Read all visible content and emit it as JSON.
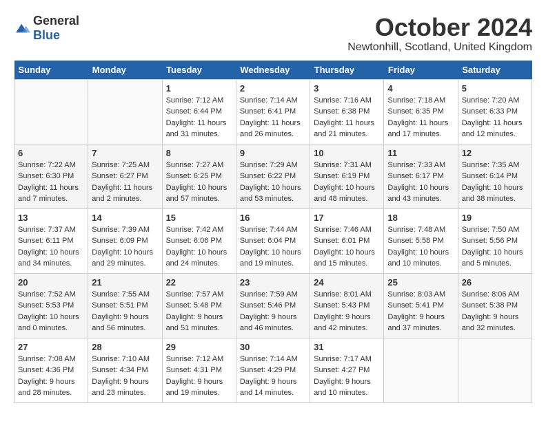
{
  "logo": {
    "general": "General",
    "blue": "Blue"
  },
  "title": "October 2024",
  "location": "Newtonhill, Scotland, United Kingdom",
  "headers": [
    "Sunday",
    "Monday",
    "Tuesday",
    "Wednesday",
    "Thursday",
    "Friday",
    "Saturday"
  ],
  "weeks": [
    [
      {
        "day": "",
        "info": ""
      },
      {
        "day": "",
        "info": ""
      },
      {
        "day": "1",
        "info": "Sunrise: 7:12 AM\nSunset: 6:44 PM\nDaylight: 11 hours and 31 minutes."
      },
      {
        "day": "2",
        "info": "Sunrise: 7:14 AM\nSunset: 6:41 PM\nDaylight: 11 hours and 26 minutes."
      },
      {
        "day": "3",
        "info": "Sunrise: 7:16 AM\nSunset: 6:38 PM\nDaylight: 11 hours and 21 minutes."
      },
      {
        "day": "4",
        "info": "Sunrise: 7:18 AM\nSunset: 6:35 PM\nDaylight: 11 hours and 17 minutes."
      },
      {
        "day": "5",
        "info": "Sunrise: 7:20 AM\nSunset: 6:33 PM\nDaylight: 11 hours and 12 minutes."
      }
    ],
    [
      {
        "day": "6",
        "info": "Sunrise: 7:22 AM\nSunset: 6:30 PM\nDaylight: 11 hours and 7 minutes."
      },
      {
        "day": "7",
        "info": "Sunrise: 7:25 AM\nSunset: 6:27 PM\nDaylight: 11 hours and 2 minutes."
      },
      {
        "day": "8",
        "info": "Sunrise: 7:27 AM\nSunset: 6:25 PM\nDaylight: 10 hours and 57 minutes."
      },
      {
        "day": "9",
        "info": "Sunrise: 7:29 AM\nSunset: 6:22 PM\nDaylight: 10 hours and 53 minutes."
      },
      {
        "day": "10",
        "info": "Sunrise: 7:31 AM\nSunset: 6:19 PM\nDaylight: 10 hours and 48 minutes."
      },
      {
        "day": "11",
        "info": "Sunrise: 7:33 AM\nSunset: 6:17 PM\nDaylight: 10 hours and 43 minutes."
      },
      {
        "day": "12",
        "info": "Sunrise: 7:35 AM\nSunset: 6:14 PM\nDaylight: 10 hours and 38 minutes."
      }
    ],
    [
      {
        "day": "13",
        "info": "Sunrise: 7:37 AM\nSunset: 6:11 PM\nDaylight: 10 hours and 34 minutes."
      },
      {
        "day": "14",
        "info": "Sunrise: 7:39 AM\nSunset: 6:09 PM\nDaylight: 10 hours and 29 minutes."
      },
      {
        "day": "15",
        "info": "Sunrise: 7:42 AM\nSunset: 6:06 PM\nDaylight: 10 hours and 24 minutes."
      },
      {
        "day": "16",
        "info": "Sunrise: 7:44 AM\nSunset: 6:04 PM\nDaylight: 10 hours and 19 minutes."
      },
      {
        "day": "17",
        "info": "Sunrise: 7:46 AM\nSunset: 6:01 PM\nDaylight: 10 hours and 15 minutes."
      },
      {
        "day": "18",
        "info": "Sunrise: 7:48 AM\nSunset: 5:58 PM\nDaylight: 10 hours and 10 minutes."
      },
      {
        "day": "19",
        "info": "Sunrise: 7:50 AM\nSunset: 5:56 PM\nDaylight: 10 hours and 5 minutes."
      }
    ],
    [
      {
        "day": "20",
        "info": "Sunrise: 7:52 AM\nSunset: 5:53 PM\nDaylight: 10 hours and 0 minutes."
      },
      {
        "day": "21",
        "info": "Sunrise: 7:55 AM\nSunset: 5:51 PM\nDaylight: 9 hours and 56 minutes."
      },
      {
        "day": "22",
        "info": "Sunrise: 7:57 AM\nSunset: 5:48 PM\nDaylight: 9 hours and 51 minutes."
      },
      {
        "day": "23",
        "info": "Sunrise: 7:59 AM\nSunset: 5:46 PM\nDaylight: 9 hours and 46 minutes."
      },
      {
        "day": "24",
        "info": "Sunrise: 8:01 AM\nSunset: 5:43 PM\nDaylight: 9 hours and 42 minutes."
      },
      {
        "day": "25",
        "info": "Sunrise: 8:03 AM\nSunset: 5:41 PM\nDaylight: 9 hours and 37 minutes."
      },
      {
        "day": "26",
        "info": "Sunrise: 8:06 AM\nSunset: 5:38 PM\nDaylight: 9 hours and 32 minutes."
      }
    ],
    [
      {
        "day": "27",
        "info": "Sunrise: 7:08 AM\nSunset: 4:36 PM\nDaylight: 9 hours and 28 minutes."
      },
      {
        "day": "28",
        "info": "Sunrise: 7:10 AM\nSunset: 4:34 PM\nDaylight: 9 hours and 23 minutes."
      },
      {
        "day": "29",
        "info": "Sunrise: 7:12 AM\nSunset: 4:31 PM\nDaylight: 9 hours and 19 minutes."
      },
      {
        "day": "30",
        "info": "Sunrise: 7:14 AM\nSunset: 4:29 PM\nDaylight: 9 hours and 14 minutes."
      },
      {
        "day": "31",
        "info": "Sunrise: 7:17 AM\nSunset: 4:27 PM\nDaylight: 9 hours and 10 minutes."
      },
      {
        "day": "",
        "info": ""
      },
      {
        "day": "",
        "info": ""
      }
    ]
  ]
}
